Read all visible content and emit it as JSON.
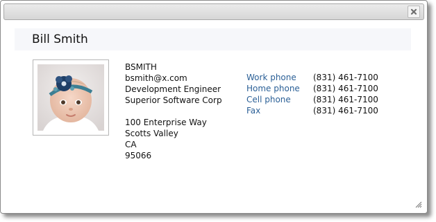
{
  "dialog": {
    "close_icon": "close-x-icon",
    "resize_icon": "resize-grip-icon"
  },
  "contact": {
    "name": "Bill Smith",
    "photo_alt": "Contact photo",
    "username": "BSMITH",
    "email": "bsmith@x.com",
    "title": "Development Engineer",
    "company": "Superior Software Corp",
    "address": {
      "street": "100 Enterprise Way",
      "city": "Scotts Valley",
      "state": "CA",
      "zip": "95066"
    },
    "phones": [
      {
        "label": "Work phone",
        "number": "(831) 461-7100"
      },
      {
        "label": "Home phone",
        "number": "(831) 461-7100"
      },
      {
        "label": "Cell phone",
        "number": "(831) 461-7100"
      },
      {
        "label": "Fax",
        "number": "(831) 461-7100"
      }
    ]
  },
  "colors": {
    "link": "#2a5f96",
    "titlebar": "#dcdcdc",
    "header_band": "#f6f7fa"
  }
}
